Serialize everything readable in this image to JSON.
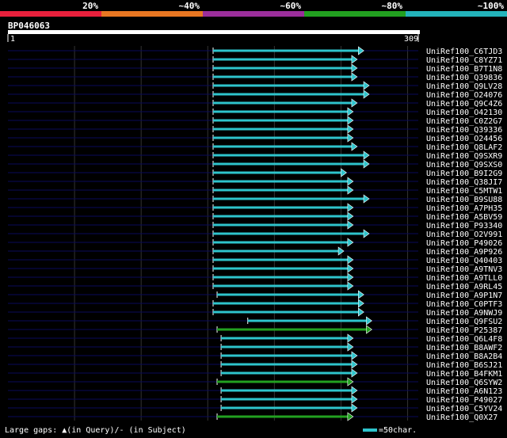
{
  "colors": {
    "identity_bands": [
      "#e8203c",
      "#e87722",
      "#9b2e9b",
      "#22a020",
      "#23b3bb"
    ],
    "high_identity": "#2ec4cc",
    "mid_identity": "#22a020",
    "grid": "#333333",
    "row_line": "#0a0a5a"
  },
  "chart_data": {
    "type": "alignment",
    "title": "BP046063",
    "query_length": 309,
    "axis": {
      "start_label": "1",
      "end_label": "309"
    },
    "identity_legend": [
      "20%",
      "~40%",
      "~60%",
      "~80%",
      "~100%"
    ],
    "rows": [
      {
        "label": "UniRef100_C6TJD3",
        "start": 155,
        "end": 264,
        "identity": "~100%"
      },
      {
        "label": "UniRef100_C8YZ71",
        "start": 155,
        "end": 259,
        "identity": "~100%"
      },
      {
        "label": "UniRef100_B7T1N8",
        "start": 155,
        "end": 259,
        "identity": "~100%"
      },
      {
        "label": "UniRef100_Q39836",
        "start": 155,
        "end": 259,
        "identity": "~100%"
      },
      {
        "label": "UniRef100_Q9LV28",
        "start": 155,
        "end": 268,
        "identity": "~100%"
      },
      {
        "label": "UniRef100_O24076",
        "start": 155,
        "end": 268,
        "identity": "~100%"
      },
      {
        "label": "UniRef100_Q9C4Z6",
        "start": 155,
        "end": 259,
        "identity": "~100%"
      },
      {
        "label": "UniRef100_O42130",
        "start": 155,
        "end": 256,
        "identity": "~100%"
      },
      {
        "label": "UniRef100_C0Z2G7",
        "start": 155,
        "end": 256,
        "identity": "~100%"
      },
      {
        "label": "UniRef100_Q39336",
        "start": 155,
        "end": 256,
        "identity": "~100%"
      },
      {
        "label": "UniRef100_O24456",
        "start": 155,
        "end": 256,
        "identity": "~100%"
      },
      {
        "label": "UniRef100_Q8LAF2",
        "start": 155,
        "end": 259,
        "identity": "~100%"
      },
      {
        "label": "UniRef100_Q9SXR9",
        "start": 155,
        "end": 268,
        "identity": "~100%"
      },
      {
        "label": "UniRef100_Q9SXS0",
        "start": 155,
        "end": 268,
        "identity": "~100%"
      },
      {
        "label": "UniRef100_B9I2G9",
        "start": 155,
        "end": 251,
        "identity": "~100%"
      },
      {
        "label": "UniRef100_Q38JI7",
        "start": 155,
        "end": 256,
        "identity": "~100%"
      },
      {
        "label": "UniRef100_C5MTW1",
        "start": 155,
        "end": 256,
        "identity": "~100%"
      },
      {
        "label": "UniRef100_B9SU88",
        "start": 155,
        "end": 268,
        "identity": "~100%"
      },
      {
        "label": "UniRef100_A7PH35",
        "start": 155,
        "end": 256,
        "identity": "~100%"
      },
      {
        "label": "UniRef100_A5BV59",
        "start": 155,
        "end": 256,
        "identity": "~100%"
      },
      {
        "label": "UniRef100_P93340",
        "start": 155,
        "end": 256,
        "identity": "~100%"
      },
      {
        "label": "UniRef100_O2V991",
        "start": 155,
        "end": 268,
        "identity": "~100%"
      },
      {
        "label": "UniRef100_P49026",
        "start": 155,
        "end": 256,
        "identity": "~100%"
      },
      {
        "label": "UniRef100_A9P926",
        "start": 155,
        "end": 249,
        "identity": "~100%"
      },
      {
        "label": "UniRef100_Q40403",
        "start": 155,
        "end": 256,
        "identity": "~100%"
      },
      {
        "label": "UniRef100_A9TNV3",
        "start": 155,
        "end": 256,
        "identity": "~100%"
      },
      {
        "label": "UniRef100_A9TLL0",
        "start": 155,
        "end": 256,
        "identity": "~100%"
      },
      {
        "label": "UniRef100_A9RL45",
        "start": 155,
        "end": 256,
        "identity": "~100%"
      },
      {
        "label": "UniRef100_A9P1N7",
        "start": 158,
        "end": 264,
        "identity": "~100%"
      },
      {
        "label": "UniRef100_C0PTF3",
        "start": 155,
        "end": 264,
        "identity": "~100%"
      },
      {
        "label": "UniRef100_A9NWJ9",
        "start": 155,
        "end": 264,
        "identity": "~100%"
      },
      {
        "label": "UniRef100_Q9FSU2",
        "start": 181,
        "end": 270,
        "identity": "~100%"
      },
      {
        "label": "UniRef100_P25387",
        "start": 158,
        "end": 270,
        "identity": "~80%"
      },
      {
        "label": "UniRef100_Q6L4F8",
        "start": 161,
        "end": 256,
        "identity": "~100%"
      },
      {
        "label": "UniRef100_B8AWF2",
        "start": 161,
        "end": 256,
        "identity": "~100%"
      },
      {
        "label": "UniRef100_B8A2B4",
        "start": 161,
        "end": 259,
        "identity": "~100%"
      },
      {
        "label": "UniRef100_B6SJ21",
        "start": 161,
        "end": 259,
        "identity": "~100%"
      },
      {
        "label": "UniRef100_B4FKM1",
        "start": 161,
        "end": 259,
        "identity": "~100%"
      },
      {
        "label": "UniRef100_Q6SYW2",
        "start": 158,
        "end": 256,
        "identity": "~80%"
      },
      {
        "label": "UniRef100_A6N123",
        "start": 161,
        "end": 259,
        "identity": "~100%"
      },
      {
        "label": "UniRef100_P49027",
        "start": 161,
        "end": 259,
        "identity": "~100%"
      },
      {
        "label": "UniRef100_C5YV24",
        "start": 161,
        "end": 259,
        "identity": "~100%"
      },
      {
        "label": "UniRef100_Q0X27",
        "start": 158,
        "end": 256,
        "identity": "~80%"
      }
    ]
  },
  "footer": {
    "gaps_text": "Large gaps: ▲(in Query)/- (in Subject)",
    "scale_text": "=50char."
  }
}
